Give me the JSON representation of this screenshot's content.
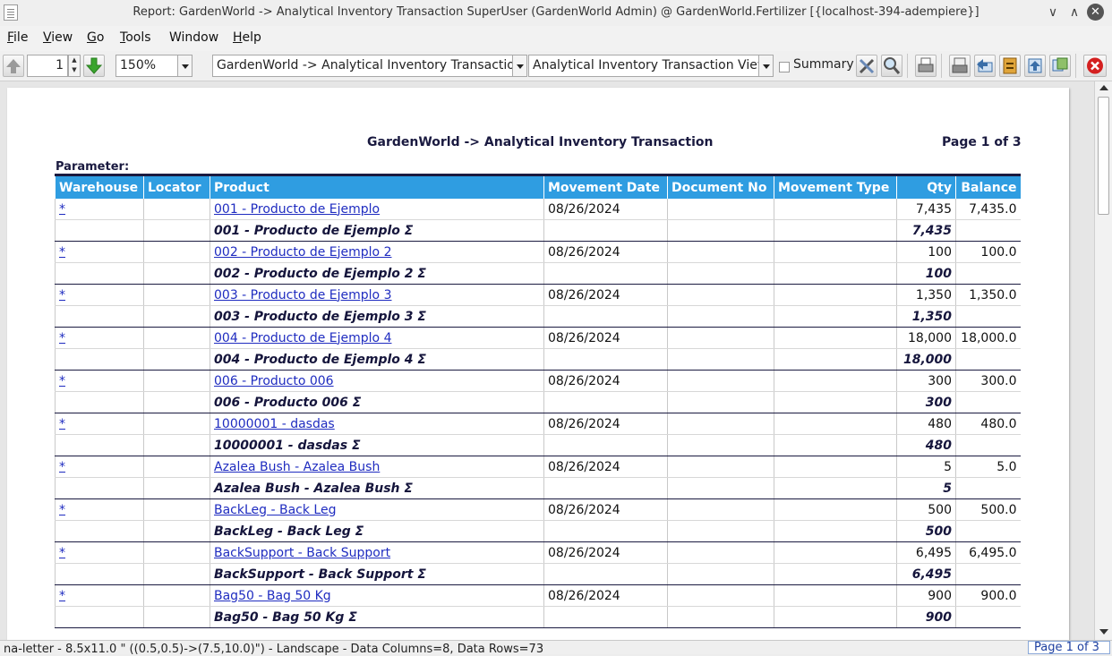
{
  "window": {
    "title": "Report: GardenWorld -> Analytical Inventory Transaction  SuperUser (GardenWorld Admin) @ GardenWorld.Fertilizer [{localhost-394-adempiere}]",
    "minimize": "∨",
    "maximize": "∧",
    "close": "✕"
  },
  "menu": {
    "file": {
      "u": "F",
      "rest": "ile"
    },
    "view": {
      "u": "V",
      "rest": "iew"
    },
    "go": {
      "u": "G",
      "rest": "o"
    },
    "tools": {
      "u": "T",
      "rest": "ools"
    },
    "window": {
      "u": "",
      "rest": "Window"
    },
    "help": {
      "u": "H",
      "rest": "elp"
    }
  },
  "toolbar": {
    "page_value": "1",
    "zoom_value": "150%",
    "report_select": "GardenWorld -> Analytical Inventory Transaction",
    "view_select": "Analytical Inventory Transaction View",
    "summary_label": "Summary"
  },
  "report": {
    "title": "GardenWorld -> Analytical Inventory Transaction",
    "page_label": "Page 1 of 3",
    "parameter_label": "Parameter:",
    "columns": [
      "Warehouse",
      "Locator",
      "Product",
      "Movement Date",
      "Document No",
      "Movement Type",
      "Qty",
      "Balance"
    ],
    "rows": [
      {
        "type": "detail",
        "warehouse": "*",
        "locator": "",
        "product": "001 - Producto de Ejemplo",
        "date": "08/26/2024",
        "doc": "",
        "mtype": "",
        "qty": "7,435",
        "balance": "7,435.0"
      },
      {
        "type": "sum",
        "warehouse": "",
        "locator": "",
        "product": "001 - Producto de Ejemplo Σ",
        "date": "",
        "doc": "",
        "mtype": "",
        "qty": "7,435",
        "balance": ""
      },
      {
        "type": "detail",
        "warehouse": "*",
        "locator": "",
        "product": "002 - Producto de Ejemplo 2",
        "date": "08/26/2024",
        "doc": "",
        "mtype": "",
        "qty": "100",
        "balance": "100.0"
      },
      {
        "type": "sum",
        "warehouse": "",
        "locator": "",
        "product": "002 - Producto de Ejemplo 2 Σ",
        "date": "",
        "doc": "",
        "mtype": "",
        "qty": "100",
        "balance": ""
      },
      {
        "type": "detail",
        "warehouse": "*",
        "locator": "",
        "product": "003 - Producto de Ejemplo 3",
        "date": "08/26/2024",
        "doc": "",
        "mtype": "",
        "qty": "1,350",
        "balance": "1,350.0"
      },
      {
        "type": "sum",
        "warehouse": "",
        "locator": "",
        "product": "003 - Producto de Ejemplo 3 Σ",
        "date": "",
        "doc": "",
        "mtype": "",
        "qty": "1,350",
        "balance": ""
      },
      {
        "type": "detail",
        "warehouse": "*",
        "locator": "",
        "product": "004 - Producto de Ejemplo 4",
        "date": "08/26/2024",
        "doc": "",
        "mtype": "",
        "qty": "18,000",
        "balance": "18,000.0"
      },
      {
        "type": "sum",
        "warehouse": "",
        "locator": "",
        "product": "004 - Producto de Ejemplo 4 Σ",
        "date": "",
        "doc": "",
        "mtype": "",
        "qty": "18,000",
        "balance": ""
      },
      {
        "type": "detail",
        "warehouse": "*",
        "locator": "",
        "product": "006 - Producto 006",
        "date": "08/26/2024",
        "doc": "",
        "mtype": "",
        "qty": "300",
        "balance": "300.0"
      },
      {
        "type": "sum",
        "warehouse": "",
        "locator": "",
        "product": "006 - Producto 006 Σ",
        "date": "",
        "doc": "",
        "mtype": "",
        "qty": "300",
        "balance": ""
      },
      {
        "type": "detail",
        "warehouse": "*",
        "locator": "",
        "product": "10000001 - dasdas",
        "date": "08/26/2024",
        "doc": "",
        "mtype": "",
        "qty": "480",
        "balance": "480.0"
      },
      {
        "type": "sum",
        "warehouse": "",
        "locator": "",
        "product": "10000001 - dasdas Σ",
        "date": "",
        "doc": "",
        "mtype": "",
        "qty": "480",
        "balance": ""
      },
      {
        "type": "detail",
        "warehouse": "*",
        "locator": "",
        "product": "Azalea Bush - Azalea Bush",
        "date": "08/26/2024",
        "doc": "",
        "mtype": "",
        "qty": "5",
        "balance": "5.0"
      },
      {
        "type": "sum",
        "warehouse": "",
        "locator": "",
        "product": "Azalea Bush - Azalea Bush Σ",
        "date": "",
        "doc": "",
        "mtype": "",
        "qty": "5",
        "balance": ""
      },
      {
        "type": "detail",
        "warehouse": "*",
        "locator": "",
        "product": "BackLeg - Back Leg",
        "date": "08/26/2024",
        "doc": "",
        "mtype": "",
        "qty": "500",
        "balance": "500.0"
      },
      {
        "type": "sum",
        "warehouse": "",
        "locator": "",
        "product": "BackLeg - Back Leg Σ",
        "date": "",
        "doc": "",
        "mtype": "",
        "qty": "500",
        "balance": ""
      },
      {
        "type": "detail",
        "warehouse": "*",
        "locator": "",
        "product": "BackSupport - Back Support",
        "date": "08/26/2024",
        "doc": "",
        "mtype": "",
        "qty": "6,495",
        "balance": "6,495.0"
      },
      {
        "type": "sum",
        "warehouse": "",
        "locator": "",
        "product": "BackSupport - Back Support Σ",
        "date": "",
        "doc": "",
        "mtype": "",
        "qty": "6,495",
        "balance": ""
      },
      {
        "type": "detail",
        "warehouse": "*",
        "locator": "",
        "product": "Bag50 - Bag 50 Kg",
        "date": "08/26/2024",
        "doc": "",
        "mtype": "",
        "qty": "900",
        "balance": "900.0"
      },
      {
        "type": "sum",
        "warehouse": "",
        "locator": "",
        "product": "Bag50 - Bag 50 Kg Σ",
        "date": "",
        "doc": "",
        "mtype": "",
        "qty": "900",
        "balance": ""
      }
    ]
  },
  "status": {
    "text": "na-letter - 8.5x11.0 \" ((0.5,0.5)->(7.5,10.0)\") - Landscape - Data Columns=8, Data Rows=73",
    "page": "Page 1 of 3"
  },
  "colors": {
    "header_bg": "#2f9de1",
    "link": "#1f2cc0",
    "title_text": "#1a1a40",
    "close_red": "#d42020"
  }
}
